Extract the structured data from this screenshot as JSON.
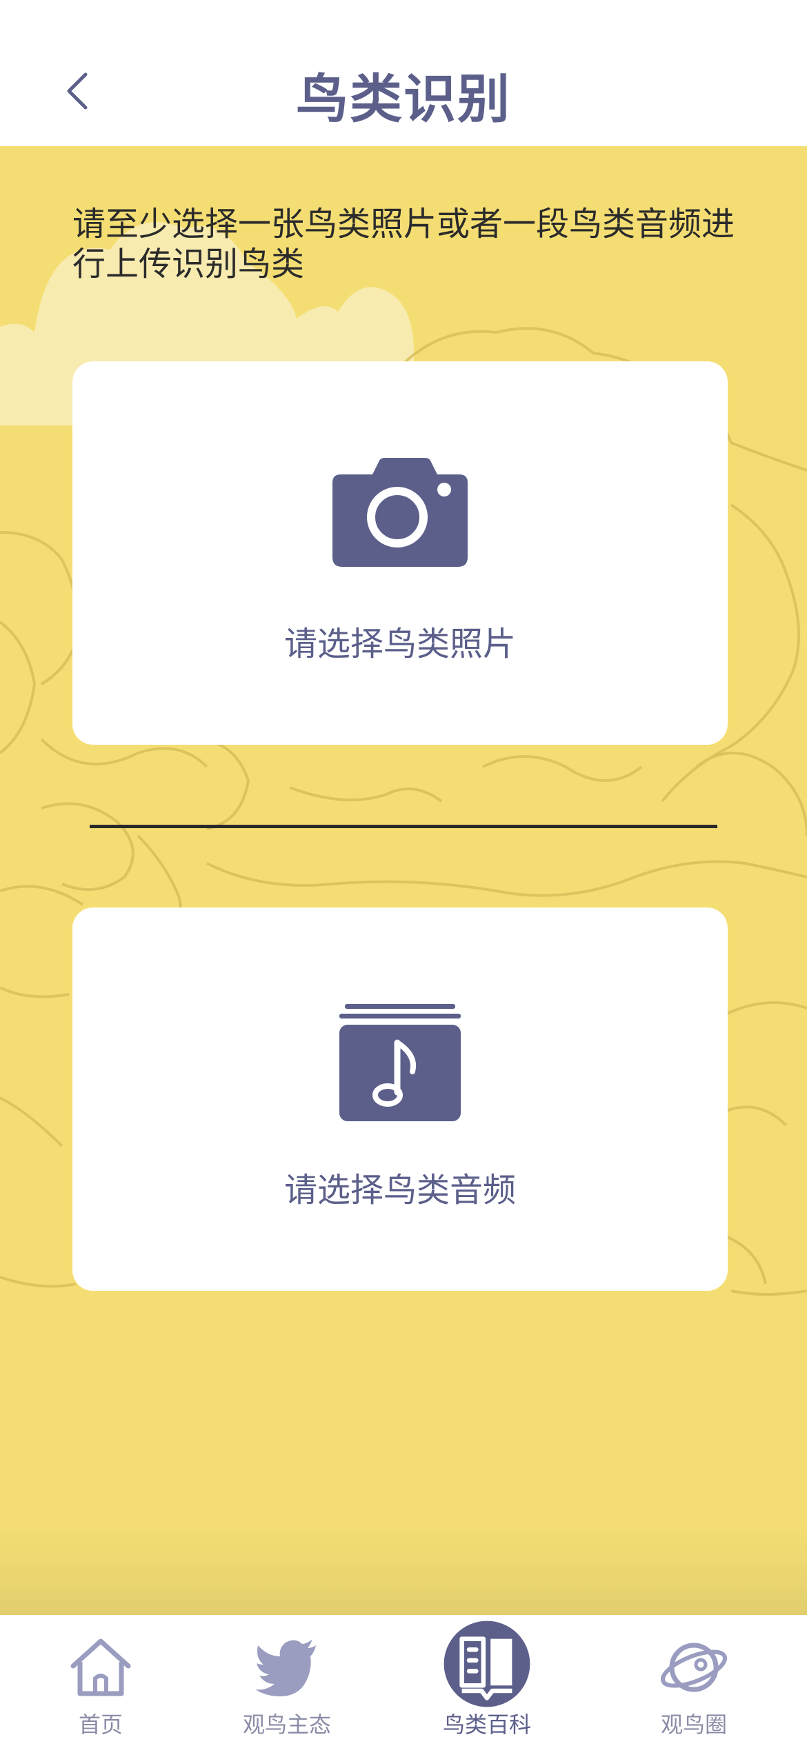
{
  "header": {
    "title": "鸟类识别"
  },
  "main": {
    "instruction": "请至少选择一张鸟类照片或者一段鸟类音频进行上传识别鸟类",
    "photo_card": {
      "label": "请选择鸟类照片",
      "icon": "camera-icon"
    },
    "audio_card": {
      "label": "请选择鸟类音频",
      "icon": "music-album-icon"
    }
  },
  "tabs": [
    {
      "label": "首页",
      "icon": "home-icon",
      "active": false
    },
    {
      "label": "观鸟主态",
      "icon": "bird-icon",
      "active": false
    },
    {
      "label": "鸟类百科",
      "icon": "book-icon",
      "active": true
    },
    {
      "label": "观鸟圈",
      "icon": "planet-icon",
      "active": false
    }
  ],
  "colors": {
    "accent": "#5b5f8a",
    "background": "#f4de73",
    "card": "#ffffff",
    "tab_inactive": "#8a8ca6"
  }
}
